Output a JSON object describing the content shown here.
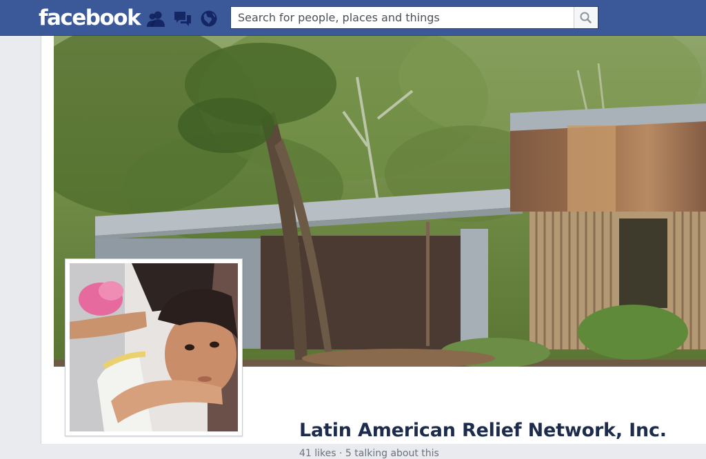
{
  "topbar": {
    "brand": "facebook",
    "icons": [
      "friend-requests-icon",
      "messages-icon",
      "notifications-globe-icon"
    ],
    "search_placeholder": "Search for people, places and things",
    "search_icon": "magnifier-icon"
  },
  "page": {
    "name": "Latin American Relief Network, Inc.",
    "likes": "41 likes",
    "separator": "·",
    "talking": "5 talking about this"
  },
  "colors": {
    "topbar": "#3b5998",
    "name": "#1d2c4c",
    "stats": "#6a7180"
  }
}
